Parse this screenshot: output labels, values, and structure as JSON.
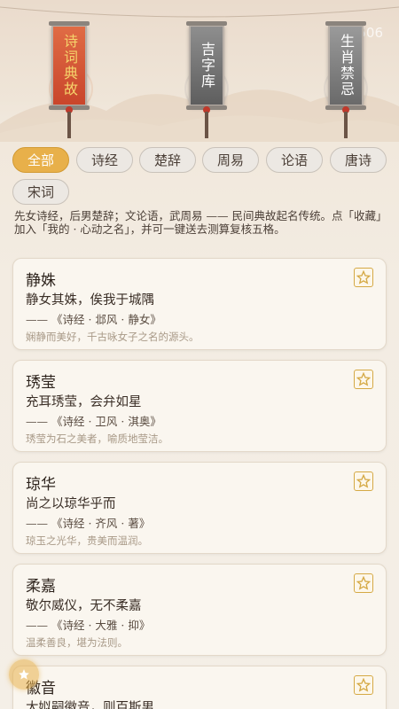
{
  "header": {
    "watermark": "gb506",
    "banners": [
      {
        "label": "诗词典故",
        "style": "red"
      },
      {
        "label": "吉字库",
        "style": "gray"
      },
      {
        "label": "生肖禁忌",
        "style": "gray"
      }
    ]
  },
  "tabs": [
    {
      "label": "全部",
      "active": true
    },
    {
      "label": "诗经",
      "active": false
    },
    {
      "label": "楚辞",
      "active": false
    },
    {
      "label": "周易",
      "active": false
    },
    {
      "label": "论语",
      "active": false
    },
    {
      "label": "唐诗",
      "active": false
    },
    {
      "label": "宋词",
      "active": false
    }
  ],
  "intro": "先女诗经，后男楚辞；文论语，武周易 —— 民间典故起名传统。点「收藏」加入「我的 · 心动之名」，并可一键送去测算复核五格。",
  "cards": [
    {
      "name": "静姝",
      "line": "静女其姝，俟我于城隅",
      "source": "—— 《诗经 · 邶风 · 静女》",
      "desc": "娴静而美好，千古咏女子之名的源头。"
    },
    {
      "name": "琇莹",
      "line": "充耳琇莹，会弁如星",
      "source": "—— 《诗经 · 卫风 · 淇奥》",
      "desc": "琇莹为石之美者，喻质地莹洁。"
    },
    {
      "name": "琼华",
      "line": "尚之以琼华乎而",
      "source": "—— 《诗经 · 齐风 · 著》",
      "desc": "琼玉之光华，贵美而温润。"
    },
    {
      "name": "柔嘉",
      "line": "敬尔威仪，无不柔嘉",
      "source": "—— 《诗经 · 大雅 · 抑》",
      "desc": "温柔善良，堪为法则。"
    },
    {
      "name": "徽音",
      "line": "大姒嗣徽音，则百斯男",
      "source": "",
      "desc": ""
    }
  ],
  "icons": {
    "star": "star-outline-icon",
    "float": "star-badge-icon"
  },
  "colors": {
    "accent": "#e8b04a",
    "banner_red": "#d4553a",
    "star": "#d5a945"
  }
}
